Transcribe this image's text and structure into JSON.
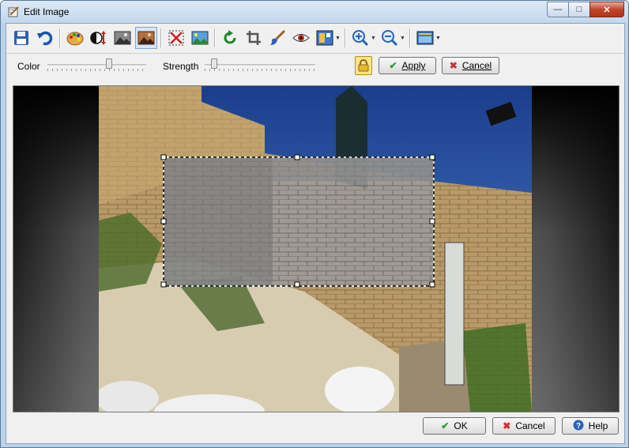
{
  "window": {
    "title": "Edit Image",
    "icon": "edit-image-icon"
  },
  "caption": {
    "minimize": "—",
    "maximize": "□",
    "close": "✕"
  },
  "toolbar": {
    "tools": [
      {
        "name": "save-icon"
      },
      {
        "name": "undo-icon"
      },
      {
        "name": "palette-icon"
      },
      {
        "name": "contrast-icon"
      },
      {
        "name": "grayscale-icon"
      },
      {
        "name": "sepia-icon"
      },
      {
        "name": "clear-selection-icon"
      },
      {
        "name": "landscape-icon"
      },
      {
        "name": "rotate-icon"
      },
      {
        "name": "crop-icon"
      },
      {
        "name": "brush-icon"
      },
      {
        "name": "red-eye-icon"
      },
      {
        "name": "frame-icon"
      },
      {
        "name": "zoom-in-icon"
      },
      {
        "name": "zoom-out-icon"
      },
      {
        "name": "display-icon"
      }
    ]
  },
  "options": {
    "color_label": "Color",
    "strength_label": "Strength",
    "color_level": 0.63,
    "strength_level": 0.06,
    "apply_label": "Apply",
    "cancel_label": "Cancel"
  },
  "footer": {
    "ok_label": "OK",
    "cancel_label": "Cancel",
    "help_label": "Help"
  },
  "colors": {
    "accent_green": "#2e9a2e",
    "cancel_red": "#d03030",
    "help_blue": "#2a62b8"
  }
}
